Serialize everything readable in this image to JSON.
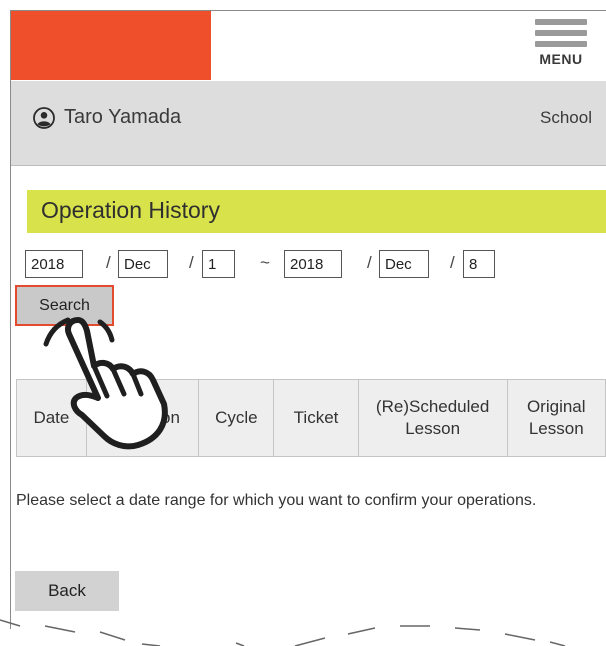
{
  "colors": {
    "brand": "#f04f2c",
    "title_band": "#d8e34b",
    "search_border": "#e24b2d"
  },
  "header": {
    "menu_label": "MENU",
    "menu_icon": "hamburger-menu-icon",
    "logo_color": "#f04f2c"
  },
  "user_bar": {
    "user_name": "Taro Yamada",
    "user_icon": "user-circle-icon",
    "school_link": "School"
  },
  "page": {
    "title": "Operation History"
  },
  "date_range": {
    "from": {
      "year": "2018",
      "month": "Dec",
      "day": "1"
    },
    "to": {
      "year": "2018",
      "month": "Dec",
      "day": "8"
    },
    "separator": "/",
    "range_symbol": "~"
  },
  "search_button": {
    "label": "Search"
  },
  "table": {
    "headers": {
      "date": "Date",
      "operation": "Operation",
      "cycle": "Cycle",
      "ticket": "Ticket",
      "rescheduled_line1": "(Re)Scheduled",
      "rescheduled_line2": "Lesson",
      "original_line1": "Original",
      "original_line2": "Lesson"
    }
  },
  "info_message": "Please select a date range for which you want to confirm your operations.",
  "back_button": {
    "label": "Back"
  },
  "cursor_icon": "hand-pointer-icon"
}
